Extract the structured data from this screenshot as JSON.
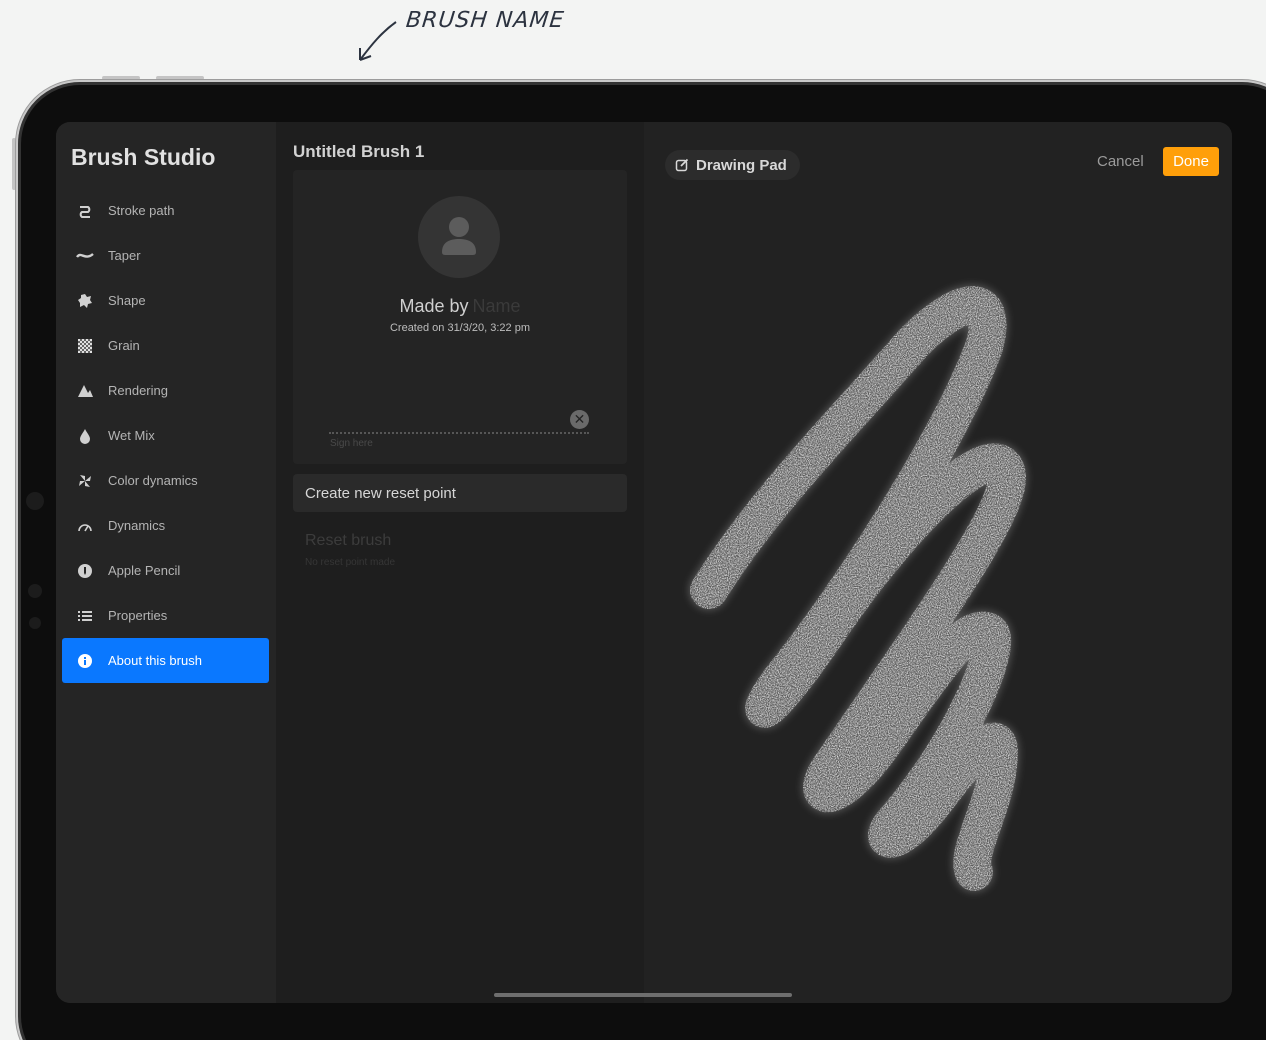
{
  "annotation": {
    "label": "BRUSH NAME"
  },
  "sidebar": {
    "title": "Brush Studio",
    "items": [
      {
        "label": "Stroke path",
        "icon": "stroke-path-icon"
      },
      {
        "label": "Taper",
        "icon": "taper-icon"
      },
      {
        "label": "Shape",
        "icon": "shape-icon"
      },
      {
        "label": "Grain",
        "icon": "grain-icon"
      },
      {
        "label": "Rendering",
        "icon": "rendering-icon"
      },
      {
        "label": "Wet Mix",
        "icon": "wet-mix-icon"
      },
      {
        "label": "Color dynamics",
        "icon": "color-dynamics-icon"
      },
      {
        "label": "Dynamics",
        "icon": "dynamics-icon"
      },
      {
        "label": "Apple Pencil",
        "icon": "apple-pencil-icon"
      },
      {
        "label": "Properties",
        "icon": "properties-icon"
      },
      {
        "label": "About this brush",
        "icon": "info-icon",
        "active": true
      }
    ]
  },
  "about": {
    "brush_name": "Untitled Brush 1",
    "made_by_label": "Made by",
    "name_placeholder": "Name",
    "created": "Created on 31/3/20, 3:22 pm",
    "sign_hint": "Sign here",
    "create_reset": "Create new reset point",
    "reset_brush": "Reset brush",
    "reset_sub": "No reset point made"
  },
  "canvas": {
    "pad_label": "Drawing Pad",
    "cancel": "Cancel",
    "done": "Done"
  },
  "colors": {
    "accent_blue": "#0a78ff",
    "done_orange": "#ff9f0a"
  }
}
